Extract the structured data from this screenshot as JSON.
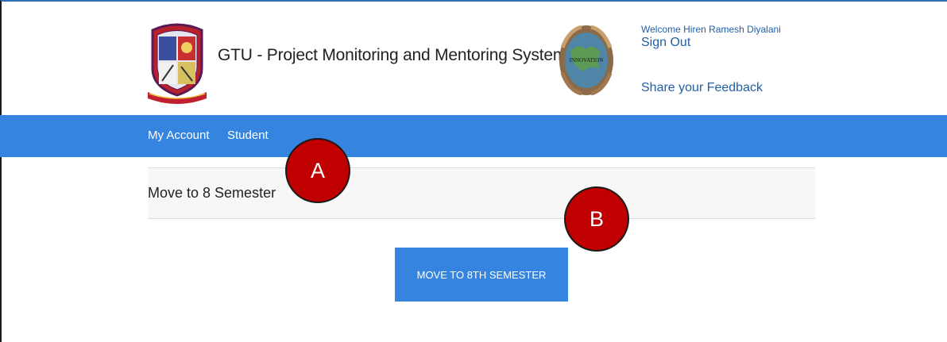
{
  "header": {
    "title": "GTU - Project Monitoring and Mentoring System",
    "welcome_text": "Welcome Hiren Ramesh Diyalani",
    "sign_out_label": "Sign Out",
    "feedback_label": "Share your Feedback",
    "innovation_logo_text": "INNOVATION"
  },
  "nav": {
    "items": [
      {
        "label": "My Account"
      },
      {
        "label": "Student"
      }
    ],
    "color": "#3584e0"
  },
  "main": {
    "panel_title": "Move to 8 Semester",
    "action_button_label": "MOVE TO 8TH SEMESTER"
  },
  "annotations": {
    "a_label": "A",
    "b_label": "B",
    "color": "#c00000"
  },
  "icons": {
    "left_logo": "gtu-crest-icon",
    "right_logo": "innovation-globe-icon"
  }
}
